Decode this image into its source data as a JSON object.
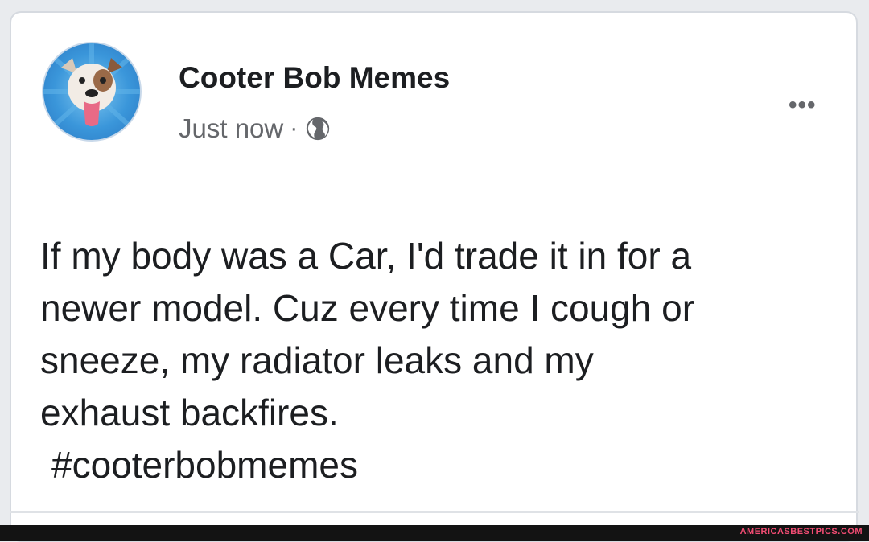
{
  "post": {
    "author": "Cooter Bob Memes",
    "timestamp": "Just now",
    "separator": "·",
    "audience_icon": "globe-icon",
    "more_icon": "•••",
    "lines": [
      "If my body was a Car, I'd trade it in for a",
      "newer model. Cuz every time I cough or",
      "sneeze, my radiator leaks and my",
      "exhaust backfires."
    ],
    "hashtag": "#cooterbobmemes"
  },
  "footer": {
    "watermark": "AMERICASBESTPICS.COM"
  },
  "colors": {
    "card_bg": "#ffffff",
    "text": "#1c1e21",
    "secondary_text": "#65676b",
    "avatar_bg": "#3a96da",
    "watermark": "#f24c73",
    "footer_bg": "#131313"
  }
}
